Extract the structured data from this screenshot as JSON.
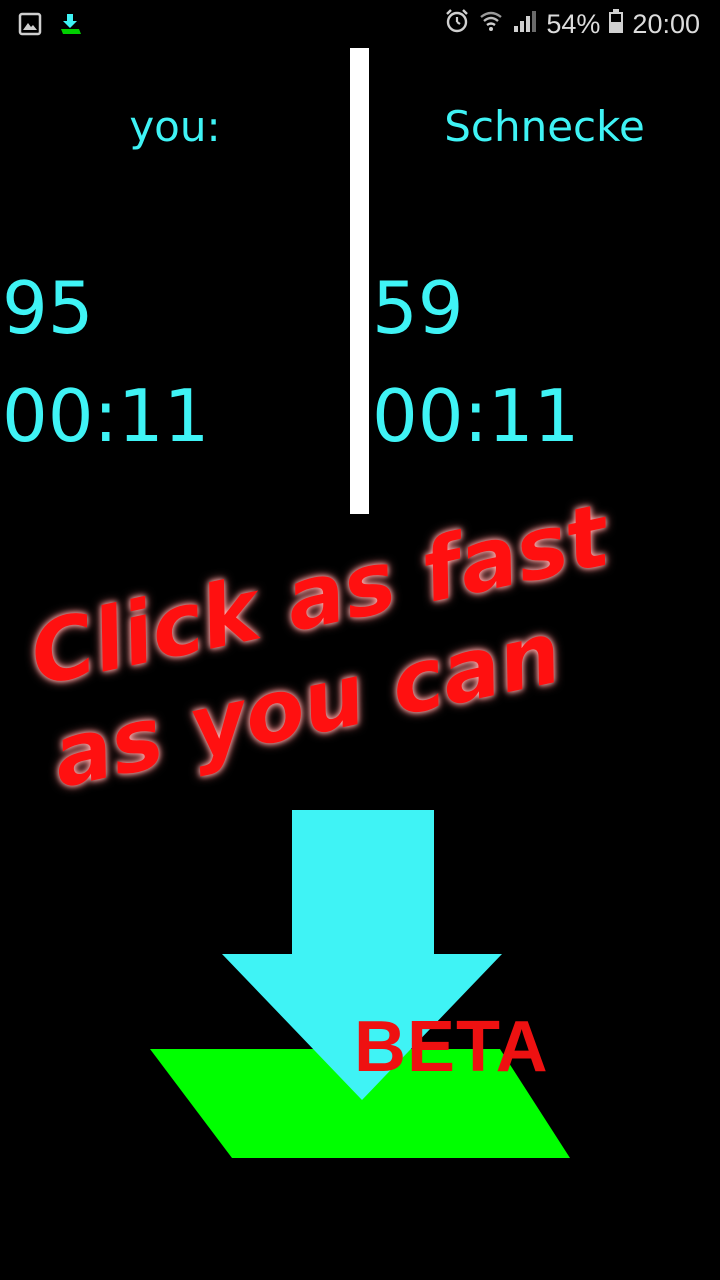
{
  "status_bar": {
    "time": "20:00",
    "battery_percent": "54%",
    "left_icons": [
      "image-icon",
      "download-icon"
    ],
    "right_icons": [
      "alarm-icon",
      "wifi-icon",
      "signal-icon",
      "battery-icon"
    ]
  },
  "players": {
    "you": {
      "label": "you:",
      "score": "95",
      "time": "00:11"
    },
    "opponent": {
      "label": "Schnecke",
      "score": "59",
      "time": "00:11"
    }
  },
  "slogan": {
    "line1": "Click as fast",
    "line2": "as you can"
  },
  "logo": {
    "badge": "BETA",
    "icon": "download-arrow-logo",
    "colors": {
      "arrow": "#3ff3f5",
      "base": "#00ff00",
      "badge": "#ee1111"
    }
  },
  "colors": {
    "accent": "#3ff3f5",
    "slogan": "#ff1010",
    "background": "#000000",
    "divider": "#ffffff"
  }
}
